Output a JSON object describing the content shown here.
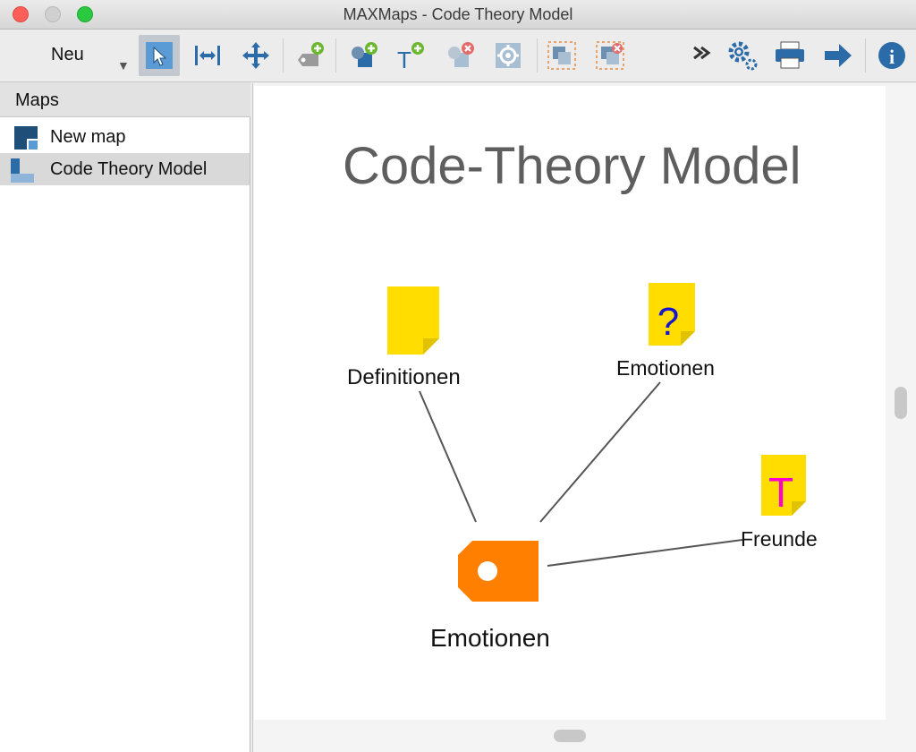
{
  "window": {
    "title": "MAXMaps - Code Theory Model"
  },
  "toolbar": {
    "new_label": "Neu",
    "dropdown_glyph": "▼",
    "buttons": [
      {
        "name": "select-tool",
        "icon": "cursor-arrow-icon",
        "active": true
      },
      {
        "name": "stretch-tool",
        "icon": "horizontal-resize-icon"
      },
      {
        "name": "move-tool",
        "icon": "move-arrows-icon"
      },
      {
        "name": "add-code",
        "icon": "add-code-icon"
      },
      {
        "name": "add-object",
        "icon": "add-object-icon"
      },
      {
        "name": "add-text",
        "icon": "add-text-icon"
      },
      {
        "name": "delete-object",
        "icon": "delete-object-icon"
      },
      {
        "name": "settings",
        "icon": "gear-icon"
      },
      {
        "name": "group",
        "icon": "group-icon"
      },
      {
        "name": "ungroup",
        "icon": "ungroup-icon"
      },
      {
        "name": "expand",
        "icon": "double-chevron-icon"
      },
      {
        "name": "options",
        "icon": "gears-icon"
      },
      {
        "name": "print",
        "icon": "printer-icon"
      },
      {
        "name": "export",
        "icon": "arrow-right-icon"
      },
      {
        "name": "info",
        "icon": "info-icon"
      }
    ],
    "info_glyph": "i",
    "text_glyph": "T"
  },
  "sidebar": {
    "header": "Maps",
    "items": [
      {
        "label": "New map",
        "icon": "new-map-icon",
        "selected": false
      },
      {
        "label": "Code Theory Model",
        "icon": "code-theory-map-icon",
        "selected": true
      }
    ]
  },
  "canvas": {
    "title": "Code-Theory Model",
    "nodes": [
      {
        "id": "definitionen",
        "label": "Definitionen",
        "type": "memo",
        "icon": "memo-icon",
        "glyph": ""
      },
      {
        "id": "emotionen-question",
        "label": "Emotionen",
        "type": "memo",
        "icon": "question-memo-icon",
        "glyph": "?"
      },
      {
        "id": "freunde",
        "label": "Freunde",
        "type": "memo",
        "icon": "theory-memo-icon",
        "glyph": "T"
      },
      {
        "id": "emotionen-code",
        "label": "Emotionen",
        "type": "code",
        "icon": "code-tag-icon"
      }
    ],
    "links": [
      {
        "from": "emotionen-code",
        "to": "definitionen"
      },
      {
        "from": "emotionen-code",
        "to": "emotionen-question"
      },
      {
        "from": "emotionen-code",
        "to": "freunde"
      }
    ]
  },
  "colors": {
    "accent": "#2b6ca8",
    "memo_yellow": "#ffdd00",
    "code_orange": "#ff8000",
    "question_mark": "#1515d0",
    "theory_t": "#ff00cc",
    "add_green": "#6ab82f",
    "delete_red": "#e26b6b"
  }
}
